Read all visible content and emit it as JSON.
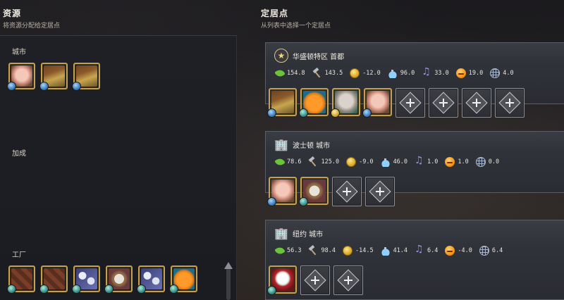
{
  "left_header": {
    "title": "资源",
    "subtitle": "将资源分配给定居点"
  },
  "right_header": {
    "title": "定居点",
    "subtitle": "从列表中选择一个定居点"
  },
  "left_panel": {
    "city_label": "城市",
    "bonus_label": "加成",
    "factory_label": "工厂",
    "city_resources": [
      {
        "icon": "pig-resource-icon",
        "badge": "blue"
      },
      {
        "icon": "tobacco-pipe-resource-icon",
        "badge": "blue"
      },
      {
        "icon": "tobacco-pipe-resource-icon",
        "badge": "blue"
      }
    ],
    "factory_resources": [
      {
        "icon": "chocolate-resource-icon",
        "badge": "teal"
      },
      {
        "icon": "chocolate-resource-icon",
        "badge": "teal"
      },
      {
        "icon": "cotton-resource-icon",
        "badge": "teal"
      },
      {
        "icon": "mug-resource-icon",
        "badge": "teal"
      },
      {
        "icon": "cotton-resource-icon",
        "badge": "teal"
      },
      {
        "icon": "citrus-resource-icon",
        "badge": "teal"
      }
    ]
  },
  "stat_icons": [
    "food-icon",
    "production-icon",
    "gold-icon",
    "science-icon",
    "culture-icon",
    "happiness-icon",
    "influence-icon"
  ],
  "settlements": [
    {
      "name": "华盛顿特区 首都",
      "icon": "capital-star-icon",
      "stats": [
        "154.8",
        "143.5",
        "-12.0",
        "96.0",
        "33.0",
        "19.0",
        "4.0"
      ],
      "resources": [
        {
          "icon": "tobacco-pipe-resource-icon",
          "badge": "blue"
        },
        {
          "icon": "citrus-resource-icon",
          "badge": "teal"
        },
        {
          "icon": "ivory-resource-icon",
          "badge": "gold"
        },
        {
          "icon": "pig-resource-icon",
          "badge": "blue"
        }
      ],
      "empty_slots": 4
    },
    {
      "name": "波士顿 城市",
      "icon": "city-building-icon",
      "stats": [
        "78.6",
        "125.0",
        "-9.0",
        "46.0",
        "1.0",
        "1.0",
        "0.0"
      ],
      "resources": [
        {
          "icon": "pig-resource-icon",
          "badge": "blue"
        },
        {
          "icon": "mug-resource-icon",
          "badge": "teal"
        }
      ],
      "empty_slots": 2
    },
    {
      "name": "纽约 城市",
      "icon": "city-building-icon",
      "stats": [
        "56.3",
        "98.4",
        "-14.5",
        "41.4",
        "6.4",
        "-4.0",
        "6.4"
      ],
      "resources": [
        {
          "icon": "sugar-resource-icon",
          "badge": "teal"
        }
      ],
      "empty_slots": 2
    }
  ]
}
